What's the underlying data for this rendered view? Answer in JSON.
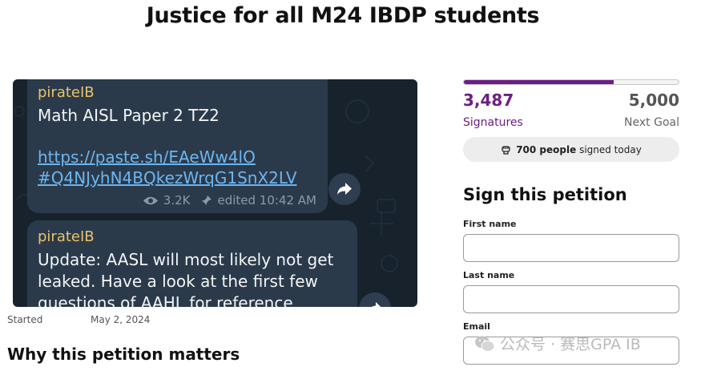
{
  "page": {
    "title": "Justice for all M24 IBDP students"
  },
  "image": {
    "message1": {
      "author": "pirateIB",
      "text": "Math AISL Paper 2 TZ2",
      "link_line1": "https://paste.sh/EAeWw4lO",
      "link_line2": "#Q4NJyhN4BQkezWrqG1SnX2LV",
      "views": "3.2K",
      "edited": "edited 10:42 AM"
    },
    "message2": {
      "author": "pirateIB",
      "text_line1": "Update: AASL will most likely not get",
      "text_line2": "leaked. Have a look at the first few",
      "text_line3": "questions of AAHL for reference"
    }
  },
  "meta": {
    "started_label": "Started",
    "started_date": "May 2, 2024"
  },
  "section": {
    "title": "Why this petition matters"
  },
  "progress": {
    "signatures": "3,487",
    "signatures_label": "Signatures",
    "goal": "5,000",
    "goal_label": "Next Goal",
    "fraction": 0.6974
  },
  "today": {
    "bold": "700 people",
    "rest": "signed today"
  },
  "form": {
    "title": "Sign this petition",
    "first_name_label": "First name",
    "last_name_label": "Last name",
    "email_label": "Email",
    "first_name_value": "",
    "last_name_value": "",
    "email_value": ""
  },
  "watermark": {
    "text": "公众号 · 赛思GPA IB"
  },
  "colors": {
    "accent": "#6b1e86",
    "tg_bg": "#17222d",
    "bubble": "#2b3a4a",
    "link": "#6cb6f2",
    "author": "#e8c36a"
  },
  "icons": [
    "eye-icon",
    "pin-icon",
    "forward-icon",
    "fist-icon",
    "wechat-icon"
  ]
}
